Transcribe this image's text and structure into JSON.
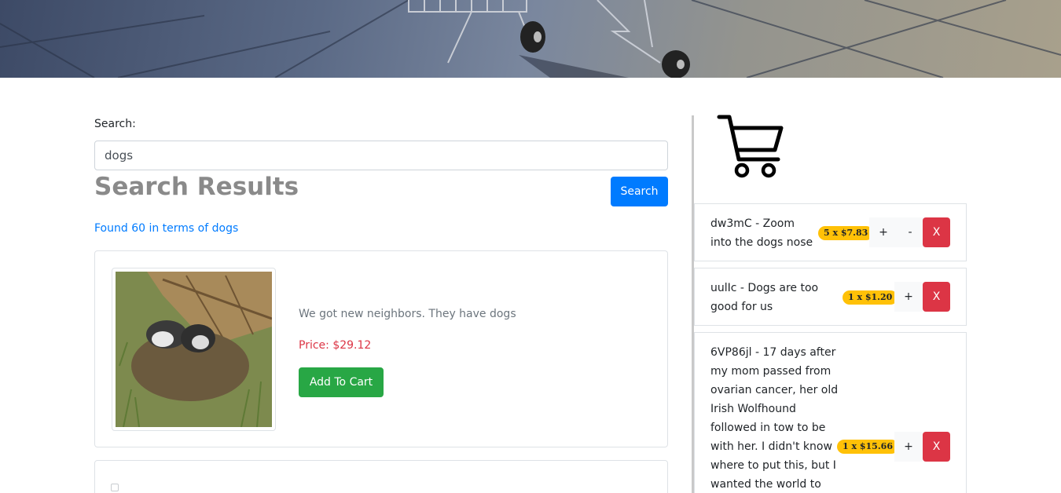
{
  "search": {
    "label": "Search:",
    "value": "dogs",
    "button": "Search"
  },
  "results": {
    "title": "Search Results",
    "found_text": "Found 60 in terms of dogs",
    "items": [
      {
        "description": "We got new neighbors. They have dogs",
        "price": "Price: $29.12",
        "button": "Add To Cart"
      }
    ]
  },
  "cart": {
    "items": [
      {
        "title": "dw3mC - Zoom into the dogs nose",
        "line1": "dw3mC - Zoom",
        "line2": "into the dogs nose",
        "qty": "5 x $7.83",
        "plus": "+",
        "minus": "-",
        "remove": "X"
      },
      {
        "title": "uulIc - Dogs are too good for us",
        "line1": "uulIc - Dogs are too",
        "line2": "good for us",
        "qty": "1 x $1.20",
        "plus": "+",
        "remove": "X"
      },
      {
        "lines": [
          "6VP86jl - 17 days after",
          "my mom passed from",
          "ovarian cancer, her old",
          "Irish Wolfhound",
          "followed in tow to be",
          "with her. I didn't know",
          "where to put this, but I",
          "wanted the world to"
        ],
        "qty": "1 x $15.66",
        "plus": "+",
        "remove": "X"
      }
    ]
  },
  "colors": {
    "primary": "#007bff",
    "success": "#28a745",
    "danger": "#dc3545",
    "warning": "#ffc107"
  }
}
